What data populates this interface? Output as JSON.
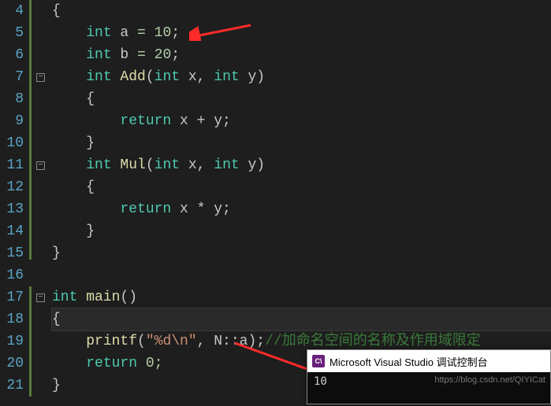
{
  "gutter": {
    "start": 4,
    "end": 21
  },
  "code": {
    "l4": "{",
    "l5_kw": "int",
    "l5_id": " a ",
    "l5_op": "= ",
    "l5_num": "10",
    "l5_end": ";",
    "l6_kw": "int",
    "l6_id": " b ",
    "l6_op": "= ",
    "l6_num": "20",
    "l6_end": ";",
    "l7_kw": "int",
    "l7_fn": " Add",
    "l7_p1": "(",
    "l7_kw2": "int",
    "l7_x": " x",
    "l7_c": ", ",
    "l7_kw3": "int",
    "l7_y": " y",
    "l7_p2": ")",
    "l8": "{",
    "l9_kw": "return",
    "l9_expr": " x + y;",
    "l10": "}",
    "l11_kw": "int",
    "l11_fn": " Mul",
    "l11_p1": "(",
    "l11_kw2": "int",
    "l11_x": " x",
    "l11_c": ", ",
    "l11_kw3": "int",
    "l11_y": " y",
    "l11_p2": ")",
    "l12": "{",
    "l13_kw": "return",
    "l13_expr": " x * y;",
    "l14": "}",
    "l15": "}",
    "l16": "",
    "l17_kw": "int",
    "l17_fn": " main",
    "l17_p": "()",
    "l18": "{",
    "l19_fn": "printf",
    "l19_p1": "(",
    "l19_str": "\"%d\\n\"",
    "l19_mid": ", N::a)",
    "l19_end": ";",
    "l19_cmt": "//加命名空间的名称及作用域限定",
    "l20_kw": "return",
    "l20_val": " 0;",
    "l21": "}"
  },
  "console": {
    "icon_text": "C\\",
    "title": "Microsoft Visual Studio 调试控制台",
    "output": "10",
    "watermark": "https://blog.csdn.net/QIYICat"
  }
}
